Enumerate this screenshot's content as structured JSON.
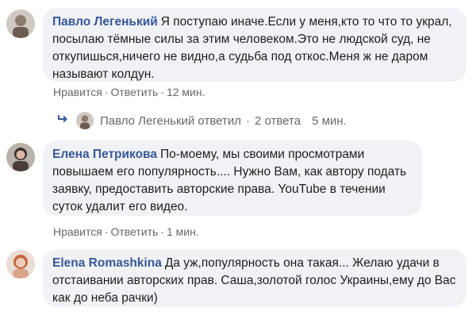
{
  "comments": [
    {
      "author": "Павло Легенький",
      "text": "Я поступаю иначе.Если у меня,кто то что то украл, посылаю тёмные силы за этим человеком.Это не людской суд, не откупишься,ничего не видно,а судьба под откос.Меня ж не даром называют колдун.",
      "like": "Нравится",
      "reply": "Ответить",
      "time": "12 мин."
    },
    {
      "author": "Елена Петрикова",
      "text": "По-моему, мы своими просмотрами повышаем его популярность.... Нужно Вам, как автору подать заявку, предоставить авторские права. YouTube в течении суток удалит его видео.",
      "like": "Нравится",
      "reply": "Ответить",
      "time": "1 мин."
    },
    {
      "author": "Elena Romashkina",
      "text": "Да уж,популярность она такая... Желаю удачи в отстаивании авторских прав. Саша,золотой голос Украины,ему до Вас как до неба рачки)"
    }
  ],
  "reply_thread": {
    "text": "Павло Легенький ответил",
    "count": "2 ответа",
    "time": "5 мин."
  },
  "icons": {
    "reply_arrow": "reply-arrow-icon",
    "separator": "·"
  },
  "colors": {
    "author": "#385898",
    "bubble": "#f0f2f5",
    "meta": "#65676b"
  }
}
